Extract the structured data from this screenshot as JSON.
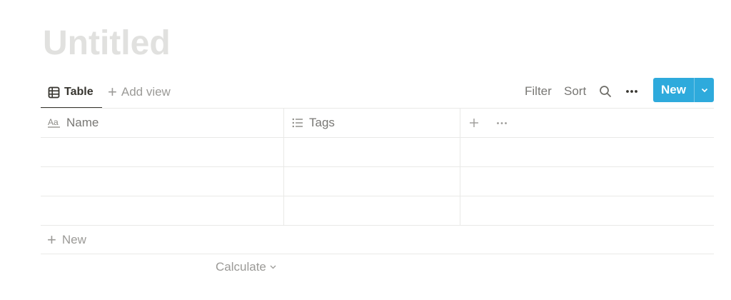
{
  "page": {
    "title": "Untitled"
  },
  "views": {
    "active_tab": "Table",
    "add_view_label": "Add view"
  },
  "toolbar": {
    "filter_label": "Filter",
    "sort_label": "Sort",
    "more_icon": "ellipsis-icon",
    "search_icon": "search-icon",
    "new_label": "New"
  },
  "table": {
    "columns": [
      {
        "label": "Name",
        "icon": "Aa"
      },
      {
        "label": "Tags",
        "icon": "list-icon"
      }
    ],
    "rows": [
      {
        "name": "",
        "tags": ""
      },
      {
        "name": "",
        "tags": ""
      },
      {
        "name": "",
        "tags": ""
      }
    ],
    "add_row_label": "New",
    "calculate_label": "Calculate"
  },
  "colors": {
    "accent": "#2eaadc",
    "title_placeholder": "#e1e1df",
    "border": "#e9e9e7",
    "muted_text": "#9b9a97"
  }
}
